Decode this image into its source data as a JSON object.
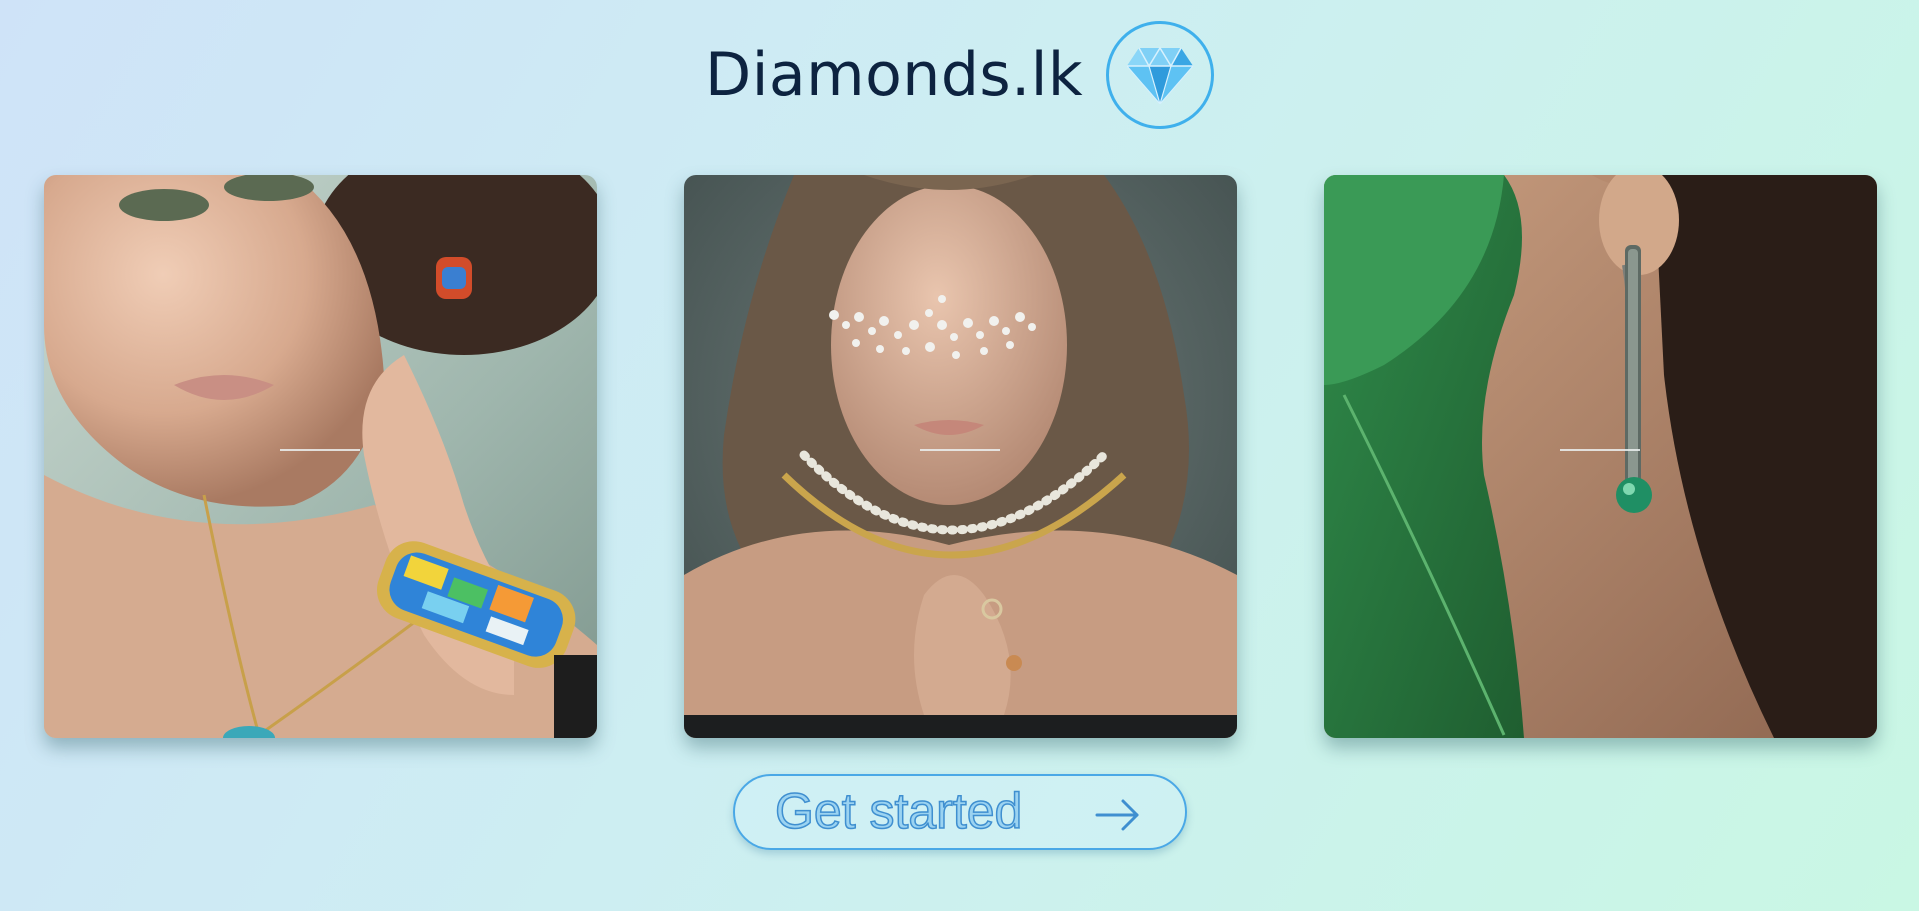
{
  "header": {
    "brand_name": "Diamonds.lk",
    "logo_icon": "diamond-icon"
  },
  "gallery": {
    "cards": [
      {
        "image": "model with colorful enamel earring, pendant necklace and bangle"
      },
      {
        "image": "model with pearl face decoration, pearl and gold necklaces and rings"
      },
      {
        "image": "close-up of ear with long drop earring with green stone beside monstera leaf"
      }
    ]
  },
  "cta": {
    "label": "Get started",
    "icon": "arrow-right-icon"
  },
  "colors": {
    "accent": "#3fb0ec",
    "brand_text": "#0d2340",
    "button_border": "#4aa8e6"
  }
}
